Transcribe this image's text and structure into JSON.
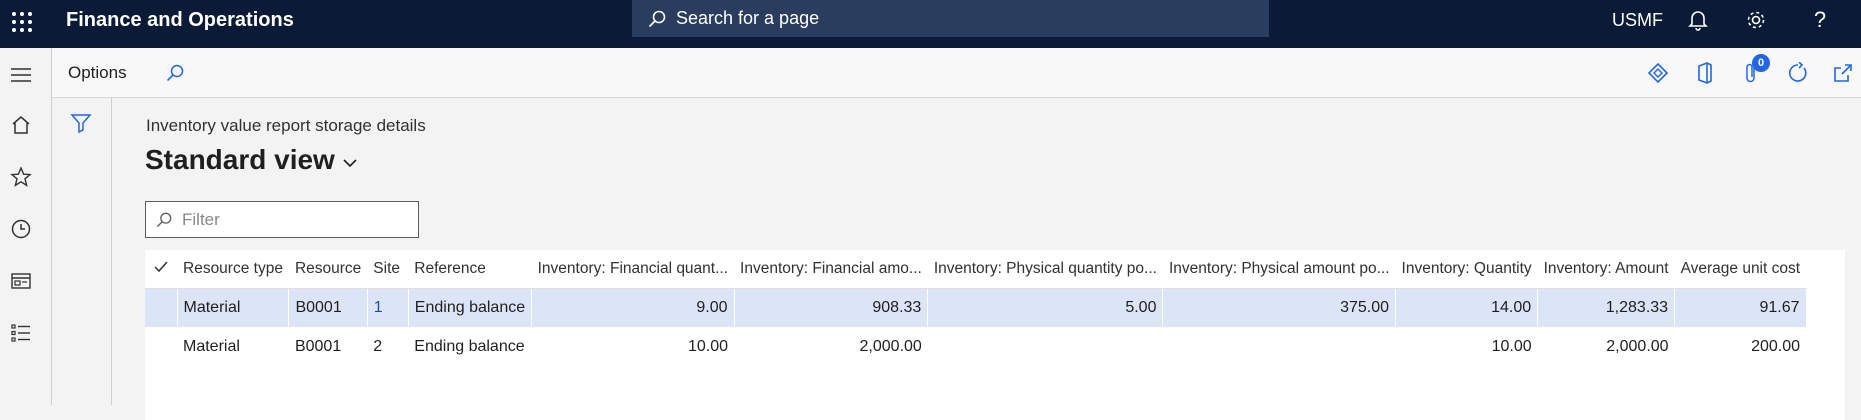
{
  "app": {
    "title": "Finance and Operations",
    "company": "USMF"
  },
  "search": {
    "placeholder": "Search for a page"
  },
  "actionbar": {
    "options_label": "Options",
    "attachments_count": "0"
  },
  "page": {
    "caption": "Inventory value report storage details",
    "view_title": "Standard view"
  },
  "filter": {
    "placeholder": "Filter"
  },
  "table": {
    "columns": [
      "Resource type",
      "Resource",
      "Site",
      "Reference",
      "Inventory: Financial quant...",
      "Inventory: Financial amo...",
      "Inventory: Physical quantity po...",
      "Inventory: Physical amount po...",
      "Inventory: Quantity",
      "Inventory: Amount",
      "Average unit cost"
    ],
    "rows": [
      [
        "Material",
        "B0001",
        "1",
        "Ending balance",
        "9.00",
        "908.33",
        "5.00",
        "375.00",
        "14.00",
        "1,283.33",
        "91.67"
      ],
      [
        "Material",
        "B0001",
        "2",
        "Ending balance",
        "10.00",
        "2,000.00",
        "",
        "",
        "10.00",
        "2,000.00",
        "200.00"
      ]
    ]
  }
}
